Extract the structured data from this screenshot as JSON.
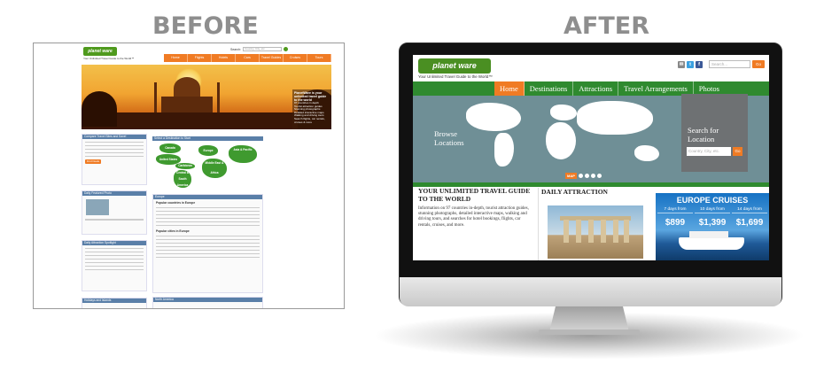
{
  "labels": {
    "before": "BEFORE",
    "after": "AFTER"
  },
  "before": {
    "logo": "planet ware",
    "tagline": "Your Unlimited Travel Guide to the World™",
    "search_label": "Search:",
    "search_placeholder": "Country, City, etc.",
    "nav": [
      "Home",
      "Flights",
      "Hotels",
      "Cars",
      "Travel Guides",
      "Cruises",
      "Tours"
    ],
    "hero_info_title": "PlanetWare is your unlimited travel guide to the world",
    "hero_info_items": [
      "97 countries in depth",
      "Tourist attraction guides",
      "Stunning photographs",
      "Detailed interactive maps",
      "Walking and driving tours",
      "Search flights, car rentals, cruises & more"
    ],
    "compare_title": "Compare Travel Sites and Save!",
    "compare_button": "Find Deals",
    "map_title": "Select a Destination to Start",
    "map_regions": [
      "Canada",
      "United States",
      "Europe",
      "Asia & Pacific",
      "Middle East & Africa",
      "Caribbean",
      "Central & South America"
    ],
    "featured_title": "Daily Featured Photo",
    "spotlight_title": "Daily Attraction Spotlight",
    "europe_title": "Europe",
    "popular_countries": "Popular countries in Europe",
    "popular_cities": "Popular cities in Europe",
    "north_america_title": "North America",
    "holidays_title": "Holidays and Islands"
  },
  "after": {
    "logo": "planet ware",
    "tagline": "Your Unlimited Travel Guide to the World™",
    "search_placeholder": "Search...",
    "search_button": "Go",
    "nav": [
      "Home",
      "Destinations",
      "Attractions",
      "Travel Arrangements",
      "Photos"
    ],
    "browse_line1": "Browse",
    "browse_line2": "Locations",
    "search_for_line1": "Search for",
    "search_for_line2": "Location",
    "location_placeholder": "Country, City, etc.",
    "location_button": "Go",
    "carousel_label": "MAP",
    "heading": "YOUR UNLIMITED TRAVEL GUIDE TO THE WORLD",
    "intro": "Information on 97 countries in-depth, tourist attraction guides, stunning photographs, detailed interactive maps, walking and driving tours, and searches for hotel bookings, flights, car rentals, cruises, and more.",
    "daily_attraction": "DAILY ATTRACTION",
    "cruise_title": "EUROPE CRUISES",
    "cruise_prices": [
      {
        "days": "7 days from",
        "price": "$899"
      },
      {
        "days": "10 days from",
        "price": "$1,399"
      },
      {
        "days": "14 days from",
        "price": "$1,699"
      }
    ]
  },
  "colors": {
    "green": "#2f8a2f",
    "orange": "#f07b24",
    "map": "#6f8f96",
    "label_gray": "#8e8e8e"
  }
}
